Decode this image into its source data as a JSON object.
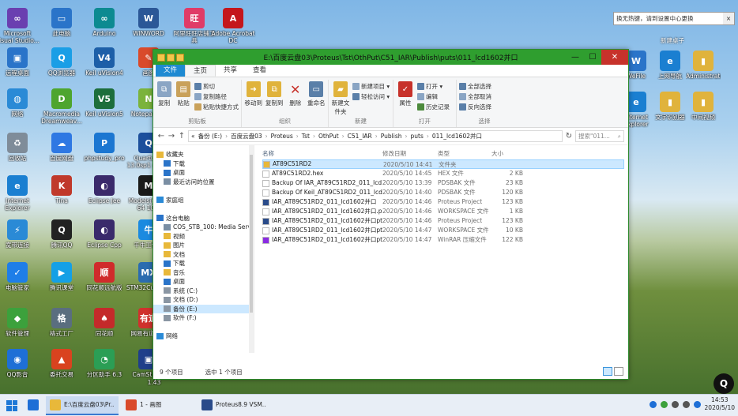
{
  "desktop": {
    "icons_left": [
      {
        "label": "Microsoft Visual Studio...",
        "color": "#6a3fb0",
        "glyph": "∞"
      },
      {
        "label": "此电脑",
        "color": "#2a74c9",
        "glyph": "▭"
      },
      {
        "label": "Arduino",
        "color": "#0d8a91",
        "glyph": "∞"
      },
      {
        "label": "WINWORD",
        "color": "#2b5797",
        "glyph": "W"
      },
      {
        "label": "阿里旺旺店铺工具",
        "color": "#e03b67",
        "glyph": "旺"
      },
      {
        "label": "Adobe Acrobat DC",
        "color": "#c4161c",
        "glyph": "A"
      },
      {
        "label": "远程桌面",
        "color": "#2a74c9",
        "glyph": "▣"
      },
      {
        "label": "QQ浏览器",
        "color": "#1a9ee6",
        "glyph": "Q"
      },
      {
        "label": "Keil uVision4",
        "color": "#1d5fa8",
        "glyph": "V4"
      },
      {
        "label": "画图",
        "color": "#d94a2b",
        "glyph": "✎"
      },
      {
        "label": "网络",
        "color": "#2a8ad6",
        "glyph": "◍"
      },
      {
        "label": "Macromedia Dreamweav...",
        "color": "#4ea52e",
        "glyph": "D"
      },
      {
        "label": "Keil uVision5",
        "color": "#1d6e3c",
        "glyph": "V5"
      },
      {
        "label": "Notepad++",
        "color": "#7bb33c",
        "glyph": "N"
      },
      {
        "label": "回收站",
        "color": "#7f8c99",
        "glyph": "♻"
      },
      {
        "label": "百度网盘",
        "color": "#2f78e3",
        "glyph": "☁"
      },
      {
        "label": "phpstudy_pro",
        "color": "#1b76d1",
        "glyph": "P"
      },
      {
        "label": "Quartus II 13.0sp1 (64-...",
        "color": "#1c4f9c",
        "glyph": "Q"
      },
      {
        "label": "Internet Explorer",
        "color": "#1a7fd1",
        "glyph": "e"
      },
      {
        "label": "Tina",
        "color": "#c0392b",
        "glyph": "K"
      },
      {
        "label": "Eclipse Jee",
        "color": "#3a2a6b",
        "glyph": "◐"
      },
      {
        "label": "Modelsim SE-64 10.4",
        "color": "#1a1a1a",
        "glyph": "M"
      },
      {
        "label": "宽带连接",
        "color": "#2a8ad6",
        "glyph": "⚡"
      },
      {
        "label": "腾讯QQ",
        "color": "#222222",
        "glyph": "Q"
      },
      {
        "label": "Eclipse Cpp",
        "color": "#3a2a6b",
        "glyph": "◐"
      },
      {
        "label": "千牛工作台",
        "color": "#1b8ae0",
        "glyph": "牛"
      },
      {
        "label": "电脑管家",
        "color": "#1e7ee8",
        "glyph": "✓"
      },
      {
        "label": "腾讯课堂",
        "color": "#14a0e6",
        "glyph": "▶"
      },
      {
        "label": "同花顺远航版",
        "color": "#d02b2b",
        "glyph": "顺"
      },
      {
        "label": "STM32CubeMX",
        "color": "#2b6cb0",
        "glyph": "MX"
      },
      {
        "label": "软件管理",
        "color": "#3ca13c",
        "glyph": "◆"
      },
      {
        "label": "格式工厂",
        "color": "#5a6e7f",
        "glyph": "格"
      },
      {
        "label": "同花顺",
        "color": "#c42a2a",
        "glyph": "♠"
      },
      {
        "label": "网易有道词典",
        "color": "#d0312d",
        "glyph": "有道"
      },
      {
        "label": "QQ影音",
        "color": "#1e6fd6",
        "glyph": "◉"
      },
      {
        "label": "委托交易",
        "color": "#d9431f",
        "glyph": "▲"
      },
      {
        "label": "分区助手 6.3",
        "color": "#2b9e55",
        "glyph": "◔"
      },
      {
        "label": "CamStudio",
        "color": "#1f3f8a",
        "glyph": "▣"
      }
    ],
    "icons_right": [
      {
        "label": "WeFile",
        "color": "#2a74c9",
        "glyph": "W"
      },
      {
        "label": "上网导航",
        "color": "#1a7fd1",
        "glyph": "e"
      },
      {
        "label": "Administrator",
        "color": "#e0b33c",
        "glyph": "▮"
      },
      {
        "label": "Internet Explorer",
        "color": "#1a7fd1",
        "glyph": "e"
      },
      {
        "label": "文字识别器",
        "color": "#e0b33c",
        "glyph": "▮"
      },
      {
        "label": "中间视频",
        "color": "#e0b33c",
        "glyph": "▮"
      }
    ],
    "partial_label": "1.43",
    "notification": {
      "text": "换无热键，请到设置中心更换",
      "close": "×"
    },
    "notification_sub": "新建桌子"
  },
  "explorer": {
    "title": "E:\\百度云盘03\\Proteus\\Tst\\OthPut\\C51_IAR\\Publish\\puts\\011_lcd1602并口",
    "controls": {
      "minimize": "—",
      "maximize": "☐",
      "close": "✕"
    },
    "tabs": [
      "文件",
      "主页",
      "共享",
      "查看"
    ],
    "ribbon": {
      "clipboard": {
        "copy": "复制",
        "paste": "粘贴",
        "cut": "剪切",
        "copy_path": "复制路径",
        "paste_shortcut": "粘贴快捷方式",
        "label": "剪贴板"
      },
      "organize": {
        "move_to": "移动到",
        "copy_to": "复制到",
        "delete": "删除",
        "rename": "重命名",
        "label": "组织"
      },
      "new": {
        "new_folder": "新建文件夹",
        "new_item": "新建项目 ▾",
        "easy_access": "轻松访问 ▾",
        "label": "新建"
      },
      "open": {
        "properties": "属性",
        "open": "打开 ▾",
        "edit": "编辑",
        "history": "历史记录",
        "label": "打开"
      },
      "select": {
        "select_all": "全部选择",
        "select_none": "全部取消",
        "invert": "反向选择",
        "label": "选择"
      }
    },
    "address": {
      "segments": [
        "«",
        "备份 (E:)",
        "百度云盘03",
        "Proteus",
        "Tst",
        "OthPut",
        "C51_IAR",
        "Publish",
        "puts",
        "011_lcd1602并口"
      ],
      "search_placeholder": "搜索\"011..."
    },
    "nav": [
      {
        "label": "收藏夹",
        "color": "#e8b83a",
        "indent": 0
      },
      {
        "label": "下载",
        "color": "#2a74c9",
        "indent": 1
      },
      {
        "label": "桌面",
        "color": "#2a74c9",
        "indent": 1
      },
      {
        "label": "最近访问的位置",
        "color": "#7a8ea3",
        "indent": 1
      },
      {
        "label": "",
        "color": "transparent",
        "indent": 0
      },
      {
        "label": "家庭组",
        "color": "#2a8ad6",
        "indent": 0
      },
      {
        "label": "",
        "color": "transparent",
        "indent": 0
      },
      {
        "label": "这台电脑",
        "color": "#2a74c9",
        "indent": 0
      },
      {
        "label": "COS_STB_100: Media Serv",
        "color": "#7a8ea3",
        "indent": 1
      },
      {
        "label": "视频",
        "color": "#e8b83a",
        "indent": 1
      },
      {
        "label": "图片",
        "color": "#e8b83a",
        "indent": 1
      },
      {
        "label": "文档",
        "color": "#e8b83a",
        "indent": 1
      },
      {
        "label": "下载",
        "color": "#2a74c9",
        "indent": 1
      },
      {
        "label": "音乐",
        "color": "#e8b83a",
        "indent": 1
      },
      {
        "label": "桌面",
        "color": "#2a74c9",
        "indent": 1
      },
      {
        "label": "系统 (C:)",
        "color": "#8a96a3",
        "indent": 1
      },
      {
        "label": "文档 (D:)",
        "color": "#8a96a3",
        "indent": 1
      },
      {
        "label": "备份 (E:)",
        "color": "#8a96a3",
        "indent": 1,
        "selected": true
      },
      {
        "label": "软件 (F:)",
        "color": "#8a96a3",
        "indent": 1
      },
      {
        "label": "",
        "color": "transparent",
        "indent": 0
      },
      {
        "label": "网络",
        "color": "#2a8ad6",
        "indent": 0
      }
    ],
    "columns": {
      "name": "名称",
      "date": "修改日期",
      "type": "类型",
      "size": "大小"
    },
    "files": [
      {
        "name": "AT89C51RD2",
        "date": "2020/5/10 14:41",
        "type": "文件夹",
        "size": "",
        "color": "#e8b83a",
        "selected": true
      },
      {
        "name": "AT89C51RD2.hex",
        "date": "2020/5/10 14:45",
        "type": "HEX 文件",
        "size": "2 KB",
        "color": "#ffffff"
      },
      {
        "name": "Backup Of IAR_AT89C51RD2_011_lcd...",
        "date": "2020/5/10 13:39",
        "type": "PDSBAK 文件",
        "size": "23 KB",
        "color": "#ffffff"
      },
      {
        "name": "Backup Of Keil_AT89C51RD2_011_lcd...",
        "date": "2020/5/10 14:40",
        "type": "PDSBAK 文件",
        "size": "120 KB",
        "color": "#ffffff"
      },
      {
        "name": "IAR_AT89C51RD2_011_lcd1602并口",
        "date": "2020/5/10 14:46",
        "type": "Proteus Project",
        "size": "123 KB",
        "color": "#2a4b8a"
      },
      {
        "name": "IAR_AT89C51RD2_011_lcd1602并口.p...",
        "date": "2020/5/10 14:46",
        "type": "WORKSPACE 文件",
        "size": "1 KB",
        "color": "#ffffff"
      },
      {
        "name": "IAR_AT89C51RD2_011_lcd1602并口pt...",
        "date": "2020/5/10 14:46",
        "type": "Proteus Project",
        "size": "123 KB",
        "color": "#2a4b8a"
      },
      {
        "name": "IAR_AT89C51RD2_011_lcd1602并口pt...",
        "date": "2020/5/10 14:47",
        "type": "WORKSPACE 文件",
        "size": "10 KB",
        "color": "#ffffff"
      },
      {
        "name": "IAR_AT89C51RD2_011_lcd1602并口pt",
        "date": "2020/5/10 14:47",
        "type": "WinRAR 压缩文件",
        "size": "122 KB",
        "color": "#8a2be2"
      }
    ],
    "status": {
      "count": "9 个项目",
      "selected": "选中 1 个项目"
    }
  },
  "taskbar": {
    "buttons": [
      {
        "label": "",
        "color": "#1e6fd6",
        "glyph": "◉"
      },
      {
        "label": "E:\\百度云盘03\\Pr...",
        "color": "#e8b83a",
        "active": true
      },
      {
        "label": "1 - 画图",
        "color": "#d94a2b"
      },
      {
        "label": "Proteus8.9 VSM...",
        "color": "#2a4b8a"
      }
    ],
    "time": "14:53",
    "date": "2020/5/10"
  }
}
